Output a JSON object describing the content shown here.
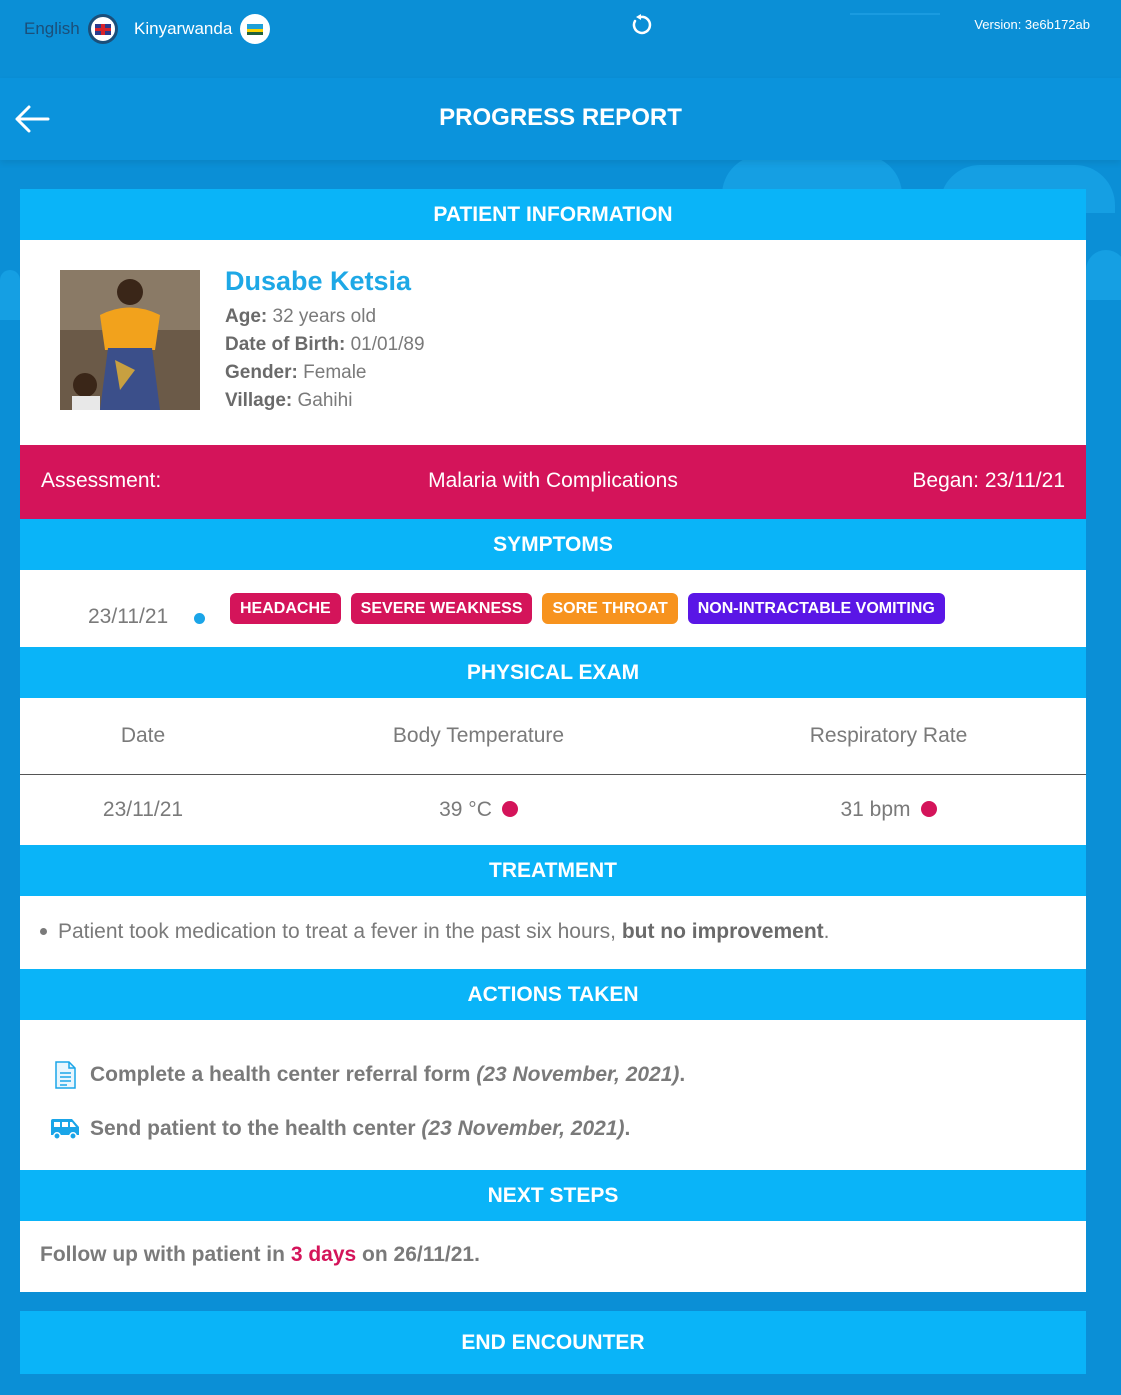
{
  "topbar": {
    "lang_english": "English",
    "lang_kinyarwanda": "Kinyarwanda",
    "version": "Version: 3e6b172ab"
  },
  "header": {
    "title": "PROGRESS REPORT"
  },
  "sections": {
    "patient_info": "PATIENT INFORMATION",
    "symptoms": "SYMPTOMS",
    "physical_exam": "PHYSICAL EXAM",
    "treatment": "TREATMENT",
    "actions_taken": "ACTIONS TAKEN",
    "next_steps": "NEXT STEPS"
  },
  "patient": {
    "name": "Dusabe Ketsia",
    "age_label": "Age:",
    "age": "32 years old",
    "dob_label": "Date of Birth:",
    "dob": "01/01/89",
    "gender_label": "Gender:",
    "gender": "Female",
    "village_label": "Village:",
    "village": "Gahihi"
  },
  "assessment": {
    "label": "Assessment:",
    "value": "Malaria with Complications",
    "began": "Began: 23/11/21"
  },
  "symptoms": {
    "date": "23/11/21",
    "tags": [
      "HEADACHE",
      "SEVERE WEAKNESS",
      "SORE THROAT",
      "NON-INTRACTABLE VOMITING"
    ]
  },
  "exam": {
    "headers": [
      "Date",
      "Body Temperature",
      "Respiratory Rate"
    ],
    "row": [
      "23/11/21",
      "39 °C",
      "31 bpm"
    ]
  },
  "treatment": {
    "text": "Patient took medication to treat a fever in the past six hours, ",
    "bold": "but no improvement",
    "end": "."
  },
  "actions": [
    {
      "text": "Complete a health center referral form ",
      "date": "(23 November, 2021)",
      "end": "."
    },
    {
      "text": "Send patient to the health center ",
      "date": "(23 November, 2021)",
      "end": "."
    }
  ],
  "next_steps": {
    "prefix": "Follow up with patient in ",
    "highlight": "3 days",
    "suffix": " on 26/11/21."
  },
  "end_button": "END ENCOUNTER",
  "colors": {
    "accent": "#0ab4f8",
    "assessment": "#d4145a",
    "tag_orange": "#f7931e",
    "tag_purple": "#5a16e6"
  }
}
